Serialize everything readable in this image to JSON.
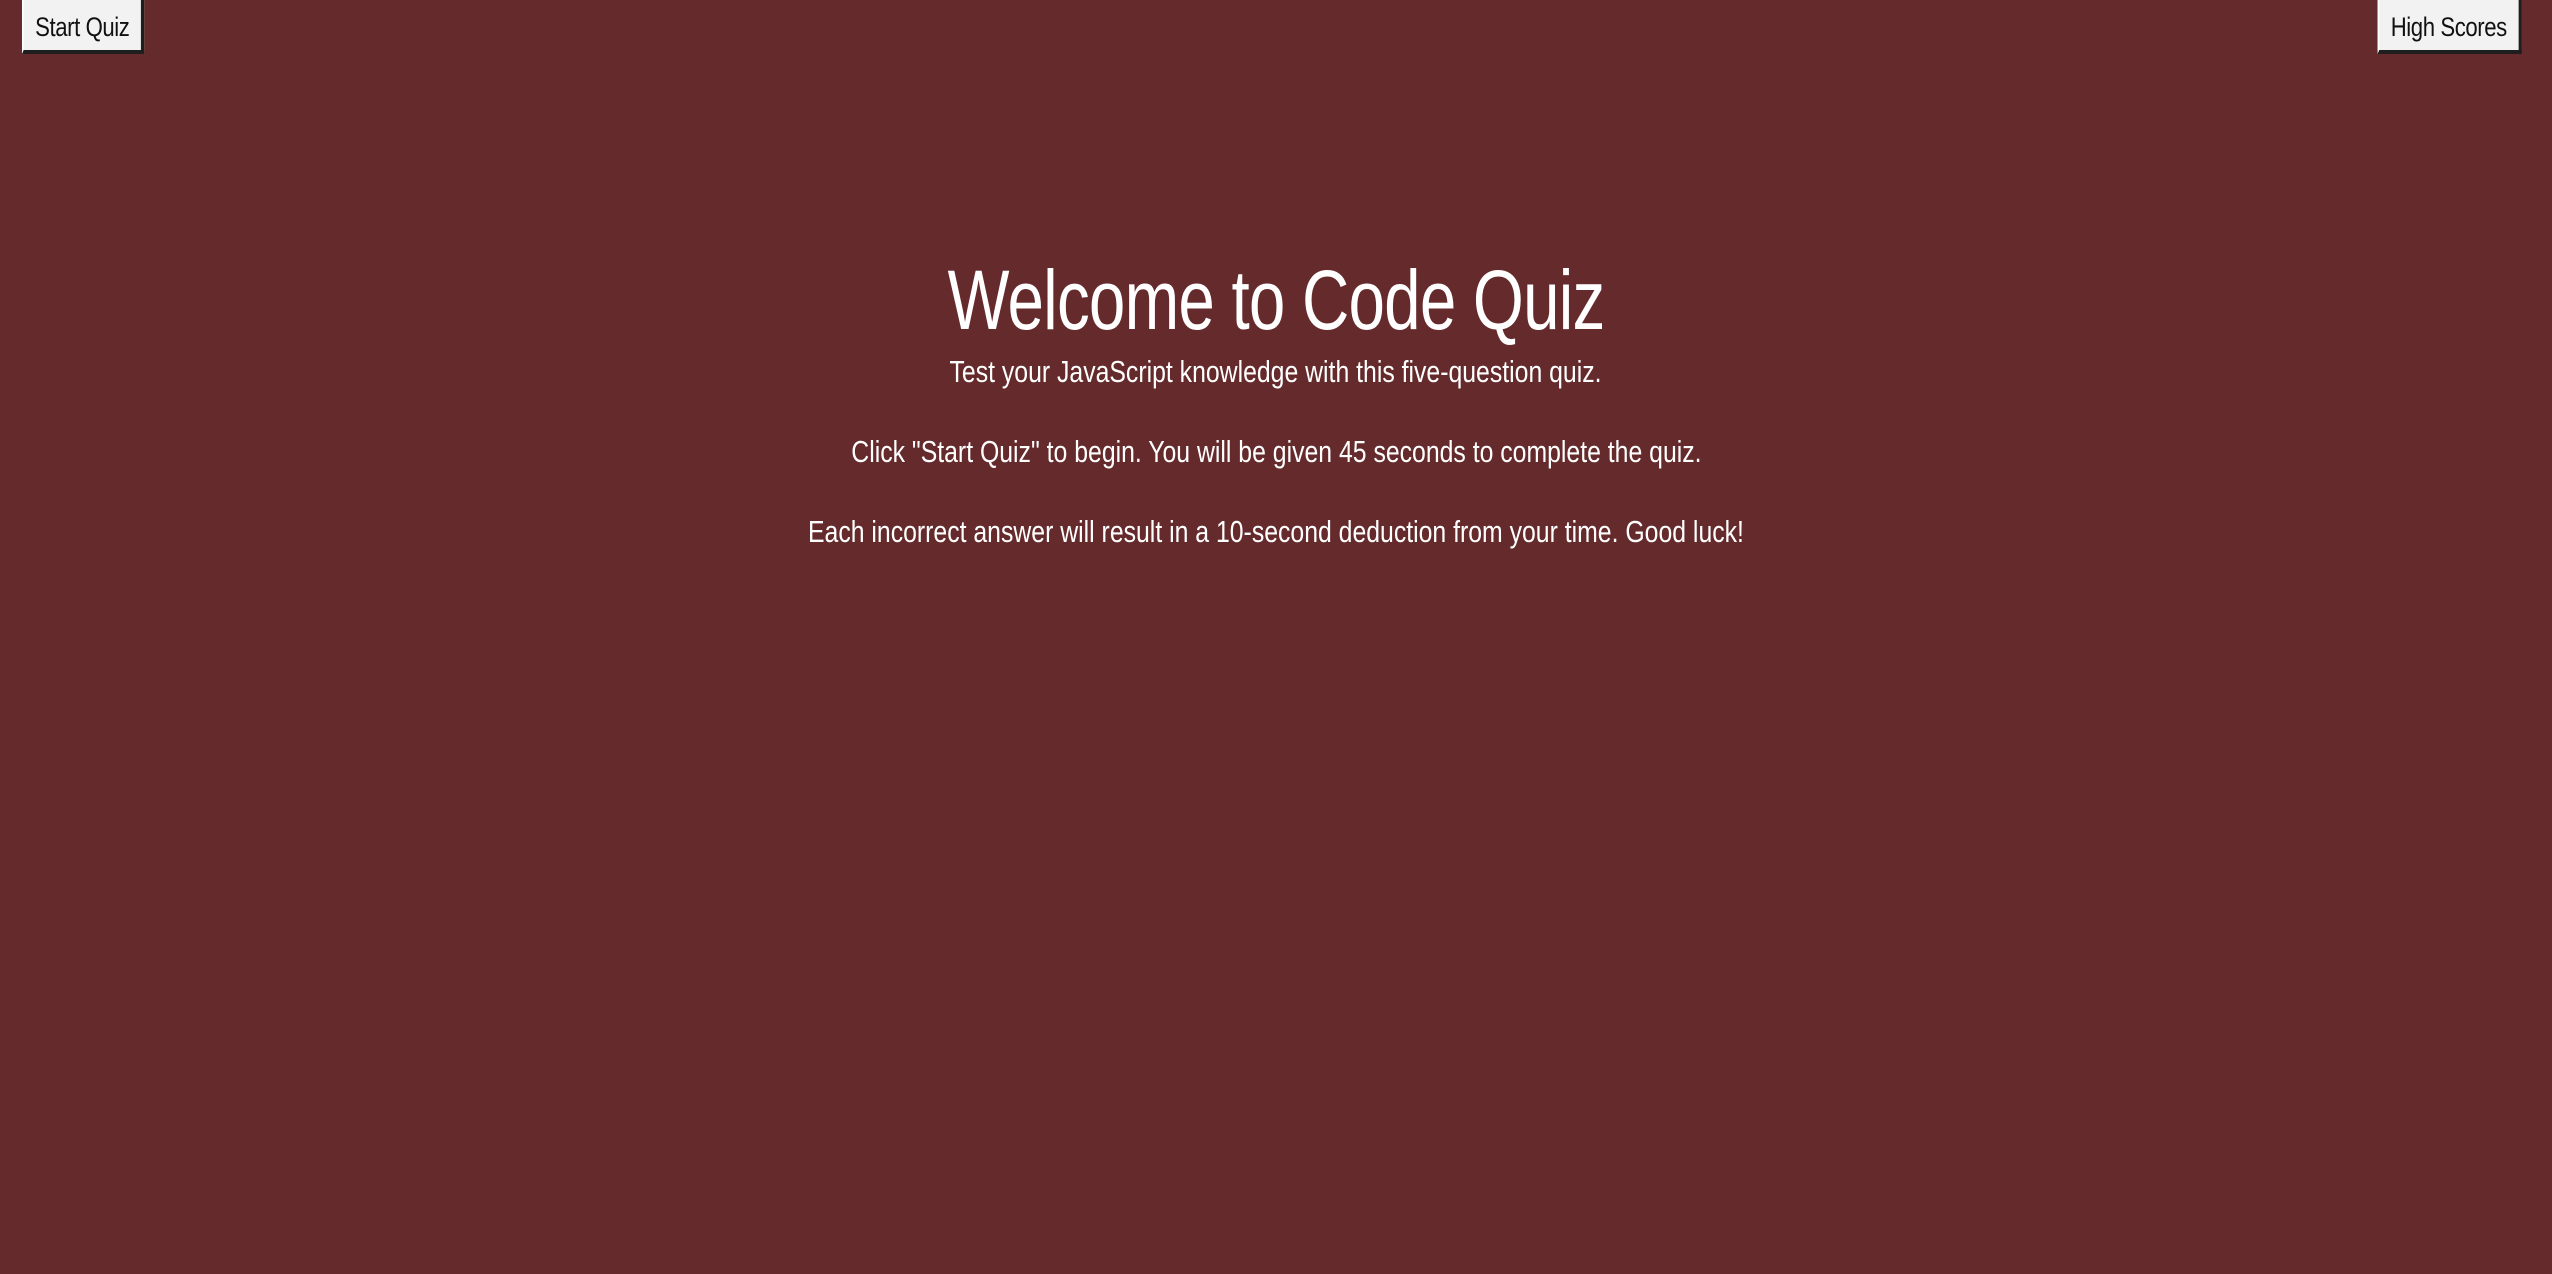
{
  "header": {
    "start_label": "Start Quiz",
    "scores_label": "High Scores"
  },
  "intro": {
    "title": "Welcome to Code Quiz",
    "line1": "Test your JavaScript knowledge with this five-question quiz.",
    "line2": "Click \"Start Quiz\" to begin. You will be given 45 seconds to complete the quiz.",
    "line3": "Each incorrect answer will result in a 10-second deduction from your time. Good luck!"
  },
  "colors": {
    "background": "#652a2b",
    "button_bg": "#f2f2f2",
    "text": "#ffffff"
  }
}
